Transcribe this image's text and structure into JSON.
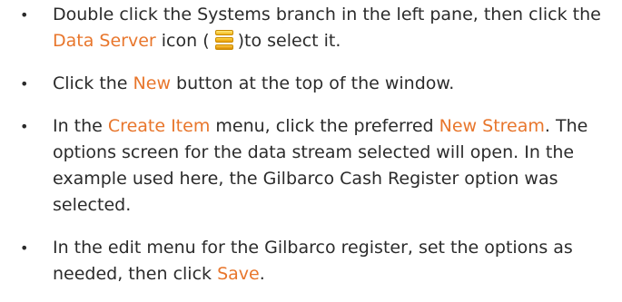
{
  "colors": {
    "text": "#2b2b2b",
    "highlight": "#e8762c",
    "icon": "#f0a800"
  },
  "bullet_glyph": "•",
  "steps": [
    {
      "p1": "Double click the Systems branch in the left pane, then click the ",
      "link1": "Data Server",
      "p2": " icon (",
      "icon": "data-server-icon",
      "p3": ")to select it."
    },
    {
      "p1": "Click the ",
      "link1": "New",
      "p2": " button at the top of the window."
    },
    {
      "p1": "In the ",
      "link1": "Create Item",
      "p2": " menu, click the preferred ",
      "link2": "New Stream",
      "p3": ". The options screen for the data stream selected will open. In the example used here, the Gilbarco Cash Register option was selected."
    },
    {
      "p1": "In the edit menu for the Gilbarco register, set the options as needed, then click ",
      "link1": "Save",
      "p2": "."
    }
  ]
}
